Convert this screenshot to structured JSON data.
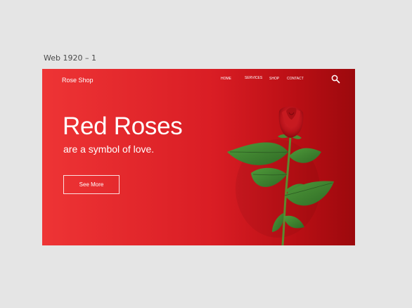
{
  "artboard": {
    "label": "Web 1920 – 1"
  },
  "header": {
    "brand": "Rose Shop",
    "nav": [
      {
        "label": "HOME"
      },
      {
        "label": "SERVICES"
      },
      {
        "label": "SHOP"
      },
      {
        "label": "CONTACT"
      }
    ],
    "search_icon": "search-icon"
  },
  "hero": {
    "title": "Red Roses",
    "subtitle": "are a symbol of love.",
    "cta_label": "See More",
    "image_icon": "rose-image"
  },
  "colors": {
    "background": "#e5e5e5",
    "hero_red_light": "#ee3435",
    "hero_red_dark": "#9c090d",
    "text": "#ffffff",
    "rose_petal": "#c4161c",
    "leaf": "#3e7d32",
    "stem": "#5b8a2e"
  }
}
